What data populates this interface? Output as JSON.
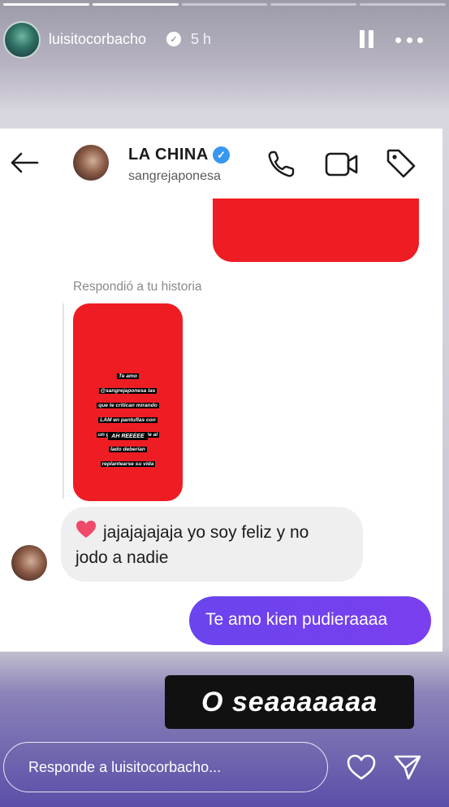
{
  "story": {
    "progress_segments": [
      {
        "state": "done"
      },
      {
        "state": "current"
      },
      {
        "state": "pending"
      },
      {
        "state": "pending"
      },
      {
        "state": "pending"
      }
    ],
    "username": "luisitocorbacho",
    "time_ago": "5 h",
    "icons": {
      "verified": "verified-badge-icon",
      "pause": "pause-icon",
      "more": "more-options-icon"
    }
  },
  "chat": {
    "contact_name": "LA CHINA",
    "contact_handle": "sangrejaponesa",
    "icons": {
      "back": "back-arrow-icon",
      "call": "phone-icon",
      "video": "video-camera-icon",
      "tag": "tag-icon"
    },
    "reply_label": "Respondió a tu historia",
    "story_reply_thumb": {
      "text_lines": [
        "Te amo",
        "@sangrejaponesa las",
        "que te critican mirando",
        "LAM en pantuflas con",
        "un gordo deprimente al",
        "lado deberían",
        "replantearse su vida"
      ],
      "tag": "AH REEEEE"
    },
    "incoming_message": {
      "emoji": "heart",
      "line1": "jajajajajaja yo soy feliz y no",
      "line2": "jodo a nadie"
    },
    "outgoing_message": "Te amo kien pudieraaaa",
    "colors": {
      "bubble_out": "#6d3df0",
      "bubble_in": "#efefef",
      "redacted": "#ee1d23"
    }
  },
  "caption": "O seaaaaaaa",
  "reply_bar": {
    "placeholder": "Responde a luisitocorbacho...",
    "icons": {
      "like": "heart-outline-icon",
      "send": "paper-plane-icon"
    }
  }
}
